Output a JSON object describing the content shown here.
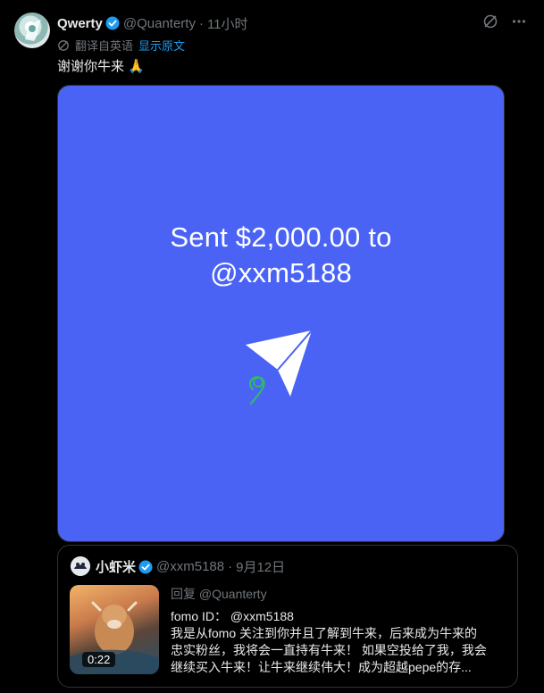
{
  "tweet": {
    "author_name": "Qwerty",
    "author_handle": "@Quanterty",
    "separator": "·",
    "time": "11小时",
    "translated_label": "翻译自英语",
    "show_original": "显示原文",
    "text": "谢谢你牛来 🙏"
  },
  "media": {
    "line1": "Sent $2,000.00 to",
    "line2": "@xxm5188",
    "background": "#4a63f5"
  },
  "quote": {
    "author_name": "小虾米",
    "author_handle": "@xxm5188",
    "separator": "·",
    "date": "9月12日",
    "reply_to": "回复 @Quanterty",
    "video_duration": "0:22",
    "line1": "fomo ID： @xxm5188",
    "line2": "我是从fomo 关注到你并且了解到牛来，后来成为牛来的",
    "line3": "忠实粉丝，我将会一直持有牛来！ 如果空投给了我，我会",
    "line4": "继续买入牛来！让牛来继续伟大！成为超越pepe的存..."
  },
  "icons": {
    "verified": "verified-badge-icon",
    "translate": "translate-icon",
    "grok": "grok-icon",
    "more": "more-icon",
    "send": "paper-plane-icon"
  },
  "colors": {
    "background": "#000000",
    "accent": "#1d9bf0",
    "muted": "#71767b",
    "media_bg": "#4a63f5"
  }
}
